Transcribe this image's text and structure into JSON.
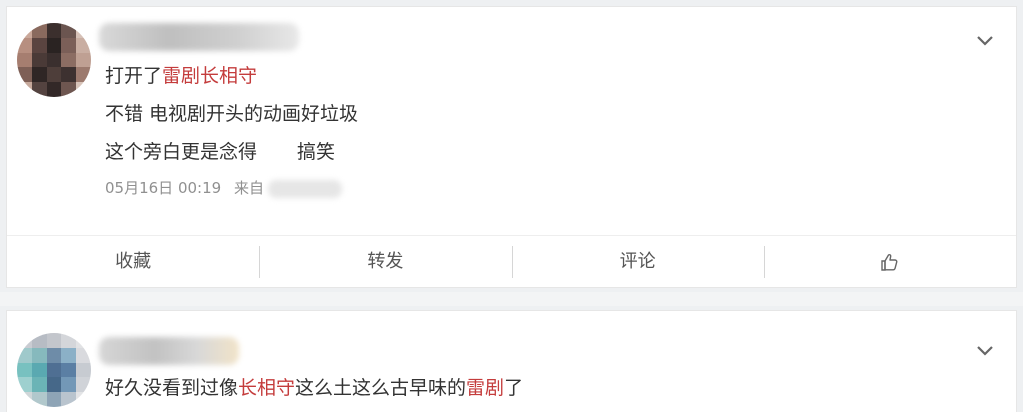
{
  "comments": [
    {
      "lines": [
        [
          {
            "t": "打开了",
            "h": false
          },
          {
            "t": "雷剧长相守",
            "h": true
          }
        ],
        [
          {
            "t": "不错 电视剧开头的动画好垃圾",
            "h": false
          }
        ],
        [
          {
            "t": "这个旁白更是念得",
            "h": false
          },
          {
            "t": "搞笑",
            "h": false
          }
        ]
      ],
      "time": "05月16日 00:19",
      "source_prefix": "来自"
    },
    {
      "lines": [
        [
          {
            "t": "好久没看到过像",
            "h": false
          },
          {
            "t": "长相守",
            "h": true
          },
          {
            "t": "这么土这么古早味的",
            "h": false
          },
          {
            "t": "雷剧",
            "h": true
          },
          {
            "t": "了",
            "h": false
          }
        ]
      ]
    }
  ],
  "actions": {
    "favorite": "收藏",
    "repost": "转发",
    "comment": "评论",
    "like_icon": "thumbs-up-icon"
  },
  "colors": {
    "highlight": "#c43c3c",
    "text": "#333333",
    "meta": "#909090"
  }
}
